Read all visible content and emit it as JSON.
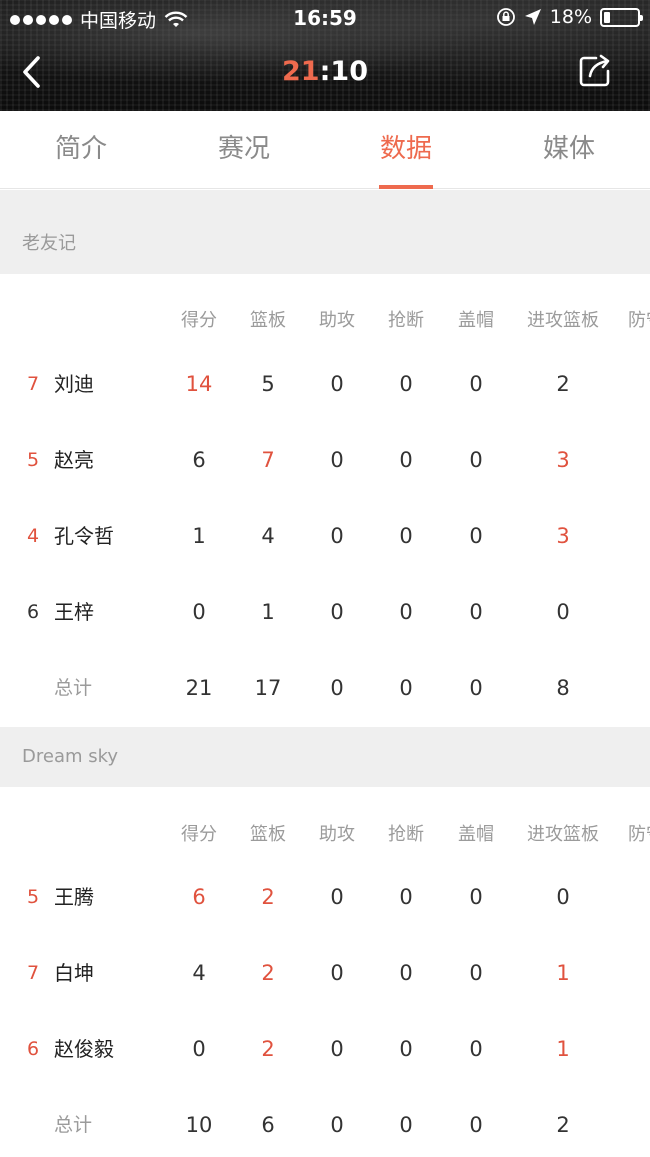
{
  "status_bar": {
    "carrier": "中国移动",
    "time": "16:59",
    "battery_text": "18%",
    "battery_level": 0.18
  },
  "nav": {
    "score_home": "21",
    "score_sep": ":",
    "score_away": "10"
  },
  "tabs": [
    "简介",
    "赛况",
    "数据",
    "媒体"
  ],
  "active_tab": "数据",
  "stat_headers": [
    "得分",
    "篮板",
    "助攻",
    "抢断",
    "盖帽",
    "进攻篮板",
    "防守"
  ],
  "teams": [
    {
      "name": "老友记",
      "players": [
        {
          "number": "7",
          "name": "刘迪",
          "stats": [
            "14",
            "5",
            "0",
            "0",
            "0",
            "2"
          ],
          "highlight": [
            true,
            false,
            false,
            false,
            false,
            false
          ]
        },
        {
          "number": "5",
          "name": "赵亮",
          "stats": [
            "6",
            "7",
            "0",
            "0",
            "0",
            "3"
          ],
          "highlight": [
            false,
            true,
            false,
            false,
            false,
            true
          ]
        },
        {
          "number": "4",
          "name": "孔令哲",
          "stats": [
            "1",
            "4",
            "0",
            "0",
            "0",
            "3"
          ],
          "highlight": [
            false,
            false,
            false,
            false,
            false,
            true
          ]
        },
        {
          "number": "6",
          "name": "王梓",
          "stats": [
            "0",
            "1",
            "0",
            "0",
            "0",
            "0"
          ],
          "highlight": [
            false,
            false,
            false,
            false,
            false,
            false
          ]
        }
      ],
      "total_label": "总计",
      "totals": [
        "21",
        "17",
        "0",
        "0",
        "0",
        "8"
      ]
    },
    {
      "name": "Dream sky",
      "players": [
        {
          "number": "5",
          "name": "王腾",
          "stats": [
            "6",
            "2",
            "0",
            "0",
            "0",
            "0"
          ],
          "highlight": [
            true,
            true,
            false,
            false,
            false,
            false
          ]
        },
        {
          "number": "7",
          "name": "白坤",
          "stats": [
            "4",
            "2",
            "0",
            "0",
            "0",
            "1"
          ],
          "highlight": [
            false,
            true,
            false,
            false,
            false,
            true
          ]
        },
        {
          "number": "6",
          "name": "赵俊毅",
          "stats": [
            "0",
            "2",
            "0",
            "0",
            "0",
            "1"
          ],
          "highlight": [
            false,
            true,
            false,
            false,
            false,
            true
          ]
        }
      ],
      "total_label": "总计",
      "totals": [
        "10",
        "6",
        "0",
        "0",
        "0",
        "2"
      ]
    }
  ],
  "colors": {
    "accent": "#ee6a4e",
    "highlight": "#e0523e",
    "band": "#efefef"
  }
}
